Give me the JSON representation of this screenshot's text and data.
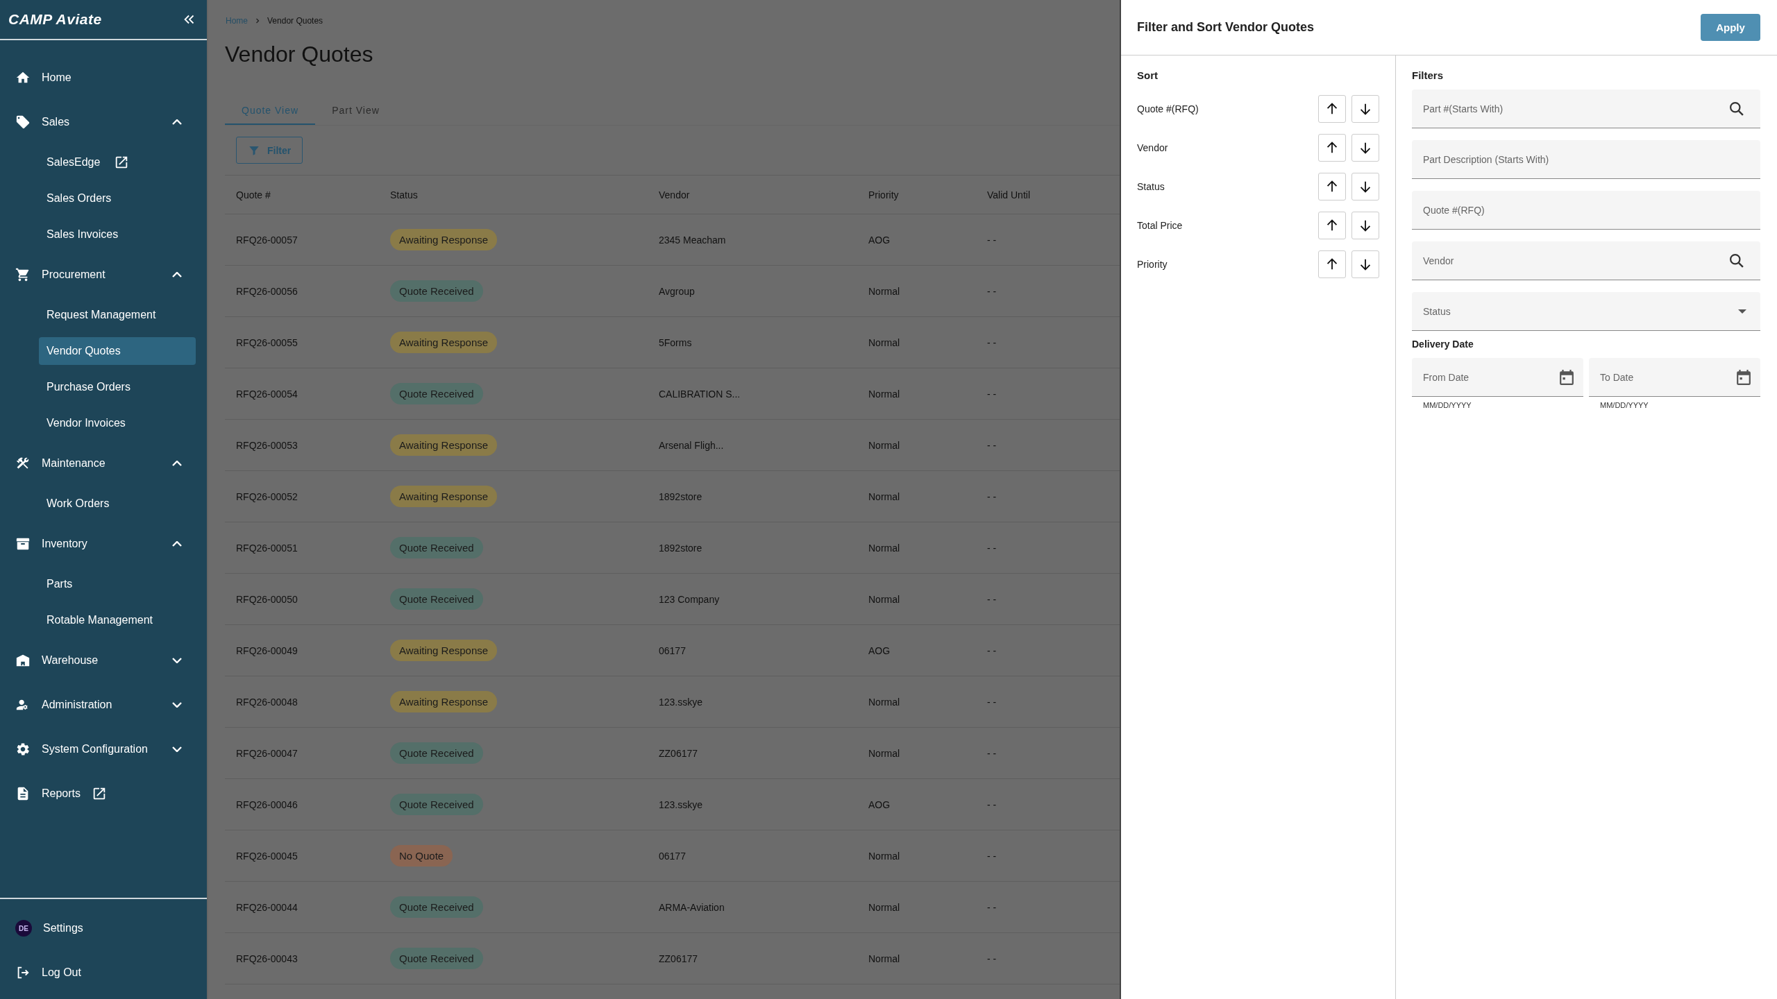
{
  "logo": "CAMP Aviate",
  "sidebar": {
    "items": [
      {
        "label": "Home"
      },
      {
        "label": "Sales",
        "expanded": true,
        "children": [
          {
            "label": "SalesEdge",
            "external": true,
            "selected": false
          },
          {
            "label": "Sales Orders",
            "selected": false
          },
          {
            "label": "Sales Invoices",
            "selected": false
          }
        ]
      },
      {
        "label": "Procurement",
        "expanded": true,
        "children": [
          {
            "label": "Request Management",
            "selected": false
          },
          {
            "label": "Vendor Quotes",
            "selected": true
          },
          {
            "label": "Purchase Orders",
            "selected": false
          },
          {
            "label": "Vendor Invoices",
            "selected": false
          }
        ]
      },
      {
        "label": "Maintenance",
        "expanded": true,
        "children": [
          {
            "label": "Work Orders",
            "selected": false
          }
        ]
      },
      {
        "label": "Inventory",
        "expanded": true,
        "children": [
          {
            "label": "Parts",
            "selected": false
          },
          {
            "label": "Rotable Management",
            "selected": false
          }
        ]
      },
      {
        "label": "Warehouse",
        "expanded": false
      },
      {
        "label": "Administration",
        "expanded": false
      },
      {
        "label": "System Configuration",
        "expanded": false
      },
      {
        "label": "Reports",
        "external": true
      }
    ],
    "footer": {
      "avatar": "DE",
      "settings": "Settings",
      "logout": "Log Out"
    }
  },
  "breadcrumb": [
    "Home",
    "Vendor Quotes"
  ],
  "title": "Vendor Quotes",
  "tabs": [
    {
      "label": "Quote View",
      "selected": true
    },
    {
      "label": "Part View",
      "selected": false
    }
  ],
  "filter_button": "Filter",
  "table": {
    "columns": [
      "Quote #",
      "Status",
      "Vendor",
      "Priority",
      "Valid Until"
    ],
    "rows": [
      {
        "quote": "RFQ26-00057",
        "status": "Awaiting Response",
        "color": "#8a7b48",
        "vendor": "2345 Meacham",
        "priority": "AOG",
        "valid": "- -"
      },
      {
        "quote": "RFQ26-00056",
        "status": "Quote Received",
        "color": "#546f69",
        "vendor": "Avgroup",
        "priority": "Normal",
        "valid": "- -"
      },
      {
        "quote": "RFQ26-00055",
        "status": "Awaiting Response",
        "color": "#8a7b48",
        "vendor": "5Forms",
        "priority": "Normal",
        "valid": "- -"
      },
      {
        "quote": "RFQ26-00054",
        "status": "Quote Received",
        "color": "#546f69",
        "vendor": "CALIBRATION S...",
        "priority": "Normal",
        "valid": "- -"
      },
      {
        "quote": "RFQ26-00053",
        "status": "Awaiting Response",
        "color": "#8a7b48",
        "vendor": "Arsenal Fligh...",
        "priority": "Normal",
        "valid": "- -"
      },
      {
        "quote": "RFQ26-00052",
        "status": "Awaiting Response",
        "color": "#8a7b48",
        "vendor": "1892store",
        "priority": "Normal",
        "valid": "- -"
      },
      {
        "quote": "RFQ26-00051",
        "status": "Quote Received",
        "color": "#546f69",
        "vendor": "1892store",
        "priority": "Normal",
        "valid": "- -"
      },
      {
        "quote": "RFQ26-00050",
        "status": "Quote Received",
        "color": "#546f69",
        "vendor": "123 Company",
        "priority": "Normal",
        "valid": "- -"
      },
      {
        "quote": "RFQ26-00049",
        "status": "Awaiting Response",
        "color": "#8a7b48",
        "vendor": "06177",
        "priority": "AOG",
        "valid": "- -"
      },
      {
        "quote": "RFQ26-00048",
        "status": "Awaiting Response",
        "color": "#8a7b48",
        "vendor": "123.sskye",
        "priority": "Normal",
        "valid": "- -"
      },
      {
        "quote": "RFQ26-00047",
        "status": "Quote Received",
        "color": "#546f69",
        "vendor": "ZZ06177",
        "priority": "Normal",
        "valid": "- -"
      },
      {
        "quote": "RFQ26-00046",
        "status": "Quote Received",
        "color": "#546f69",
        "vendor": "123.sskye",
        "priority": "AOG",
        "valid": "- -"
      },
      {
        "quote": "RFQ26-00045",
        "status": "No Quote",
        "color": "#8a6552",
        "vendor": "06177",
        "priority": "Normal",
        "valid": "- -"
      },
      {
        "quote": "RFQ26-00044",
        "status": "Quote Received",
        "color": "#546f69",
        "vendor": "ARMA-Aviation",
        "priority": "Normal",
        "valid": "- -"
      },
      {
        "quote": "RFQ26-00043",
        "status": "Quote Received",
        "color": "#546f69",
        "vendor": "ZZ06177",
        "priority": "Normal",
        "valid": "- -"
      }
    ]
  },
  "drawer": {
    "title": "Filter and Sort Vendor Quotes",
    "apply": "Apply",
    "sort": {
      "heading": "Sort",
      "fields": [
        "Quote #(RFQ)",
        "Vendor",
        "Status",
        "Total Price",
        "Priority"
      ]
    },
    "filters": {
      "heading": "Filters",
      "fields": [
        {
          "placeholder": "Part #(Starts With)",
          "kind": "search"
        },
        {
          "placeholder": "Part Description (Starts With)",
          "kind": "text"
        },
        {
          "placeholder": "Quote #(RFQ)",
          "kind": "text"
        },
        {
          "placeholder": "Vendor",
          "kind": "search"
        },
        {
          "placeholder": "Status",
          "kind": "select"
        }
      ],
      "date_heading": "Delivery Date",
      "dates": [
        {
          "placeholder": "From Date",
          "hint": "MM/DD/YYYY"
        },
        {
          "placeholder": "To Date",
          "hint": "MM/DD/YYYY"
        }
      ]
    }
  }
}
